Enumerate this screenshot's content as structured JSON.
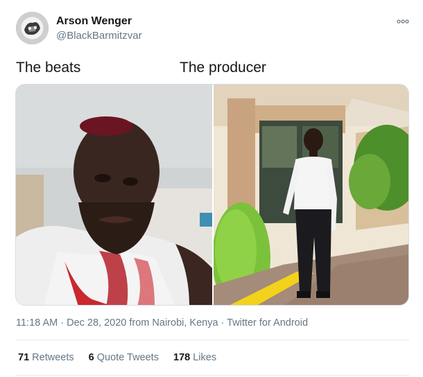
{
  "author": {
    "name": "Arson Wenger",
    "handle": "@BlackBarmitzvar",
    "avatar_icon": "avatar-photo"
  },
  "menu": {
    "icon": "more-options-icon",
    "glyph": "◦◦◦"
  },
  "captions": {
    "left": "The beats",
    "right": "The producer"
  },
  "media": {
    "left_photo": "injured-man-photo",
    "right_photo": "woman-standing-photo"
  },
  "meta": {
    "time": "11:18 AM",
    "sep1": " · ",
    "date": "Dec 28, 2020",
    "from": " from Nairobi, Kenya",
    "sep2": " · ",
    "client": "Twitter for Android"
  },
  "stats": {
    "retweets_count": "71",
    "retweets_label": " Retweets",
    "quotes_count": "6",
    "quotes_label": " Quote Tweets",
    "likes_count": "178",
    "likes_label": " Likes"
  },
  "colors": {
    "text": "#14171a",
    "secondary": "#657786",
    "divider": "#e1e8ed"
  }
}
